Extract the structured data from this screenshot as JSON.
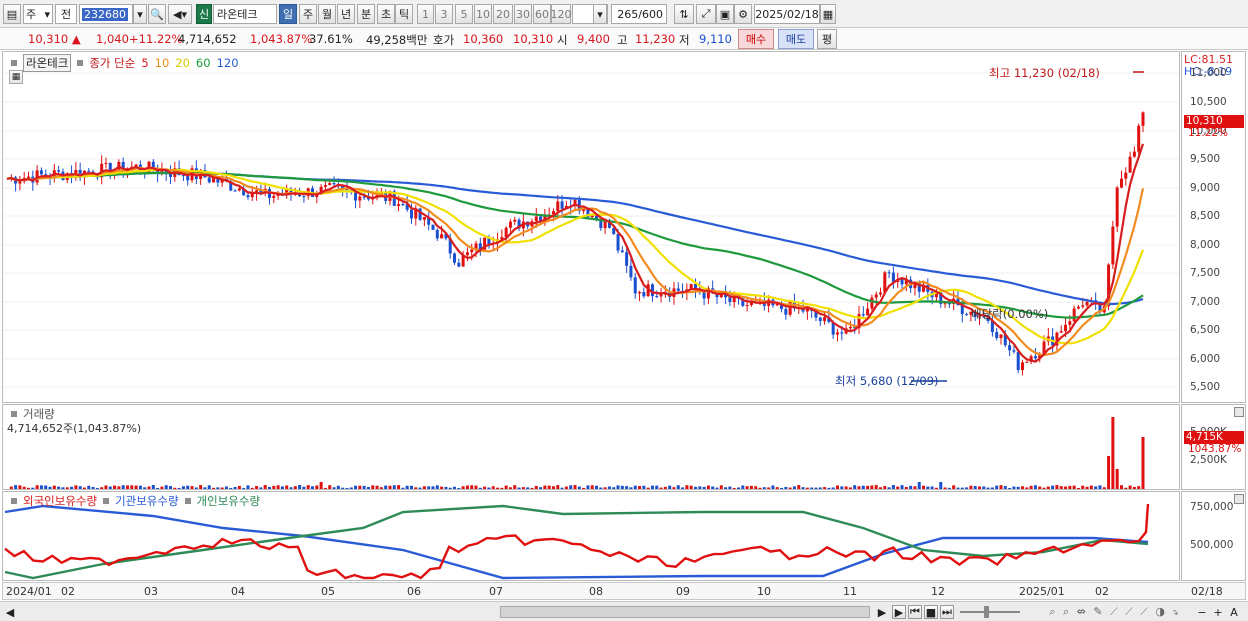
{
  "toolbar": {
    "type_select": "주",
    "prev_select": "전",
    "stock_code": "232680",
    "stock_badge": "신",
    "stock_name": "라온테크",
    "periods": [
      "일",
      "주",
      "월",
      "년",
      "분",
      "초",
      "틱"
    ],
    "active_period": "일",
    "period_numbers": [
      "1",
      "3",
      "5",
      "10",
      "20",
      "30",
      "60",
      "120"
    ],
    "count_value": "265",
    "count_max": "/600",
    "date": "2025/02/18"
  },
  "quote": {
    "price": "10,310",
    "change": "1,040",
    "change_pct": "+11.22%",
    "volume": "4,714,652",
    "volume_ratio": "1,043.87%",
    "turnover": "37.61%",
    "amount": "49,258백만",
    "bid_label": "호가",
    "bid_price": "10,360",
    "ask_price": "10,310",
    "open_label": "시",
    "open": "9,400",
    "high_label": "고",
    "high": "11,230",
    "low_label": "저",
    "low": "9,110",
    "buy_label": "매수",
    "sell_label": "매도",
    "avg_label": "평"
  },
  "price_panel": {
    "stock_tag": "라온테크",
    "ma_legend_prefix": "종가 단순",
    "ma_periods": [
      "5",
      "10",
      "20",
      "60",
      "120"
    ],
    "ma_colors": [
      "#d81e1e",
      "#f28c1e",
      "#f0e000",
      "#1e9a3c",
      "#2a5bd6"
    ],
    "high_annotation": "최고 11,230 (02/18)",
    "low_annotation": "최저 5,680 (12/09)",
    "dividend_annotation": "배당락(0.00%)",
    "lc": "LC:81.51",
    "hc": "HC:-8.19",
    "y_ticks": [
      "11,000",
      "10,500",
      "10,000",
      "9,500",
      "9,000",
      "8,500",
      "8,000",
      "7,500",
      "7,000",
      "6,500",
      "6,000",
      "5,500"
    ],
    "last_price_tag": "10,310",
    "last_pct_tag": "11.22%"
  },
  "volume_panel": {
    "title": "거래량",
    "value": "4,714,652주(1,043.87%)",
    "y_ticks": [
      "5,000K",
      "2,500K"
    ],
    "last_tag": "4,715K",
    "last_pct": "1043.87%"
  },
  "holdings_panel": {
    "legend": [
      "외국인보유수량",
      "기관보유수량",
      "개인보유수량"
    ],
    "colors": [
      "#e01010",
      "#2a5bd6",
      "#2e8b57"
    ],
    "y_ticks": [
      "750,000",
      "500,000"
    ]
  },
  "time_axis": {
    "labels": [
      "2024/01",
      "02",
      "03",
      "04",
      "05",
      "06",
      "07",
      "08",
      "09",
      "10",
      "11",
      "12",
      "2025/01",
      "02"
    ],
    "last": "02/18"
  },
  "scroll": {
    "left": "◀",
    "right": "▶",
    "controls": [
      "▶",
      "⏮",
      "■",
      "⏭"
    ],
    "zoom_out": "−",
    "zoom_in": "+",
    "auto": "A"
  }
}
